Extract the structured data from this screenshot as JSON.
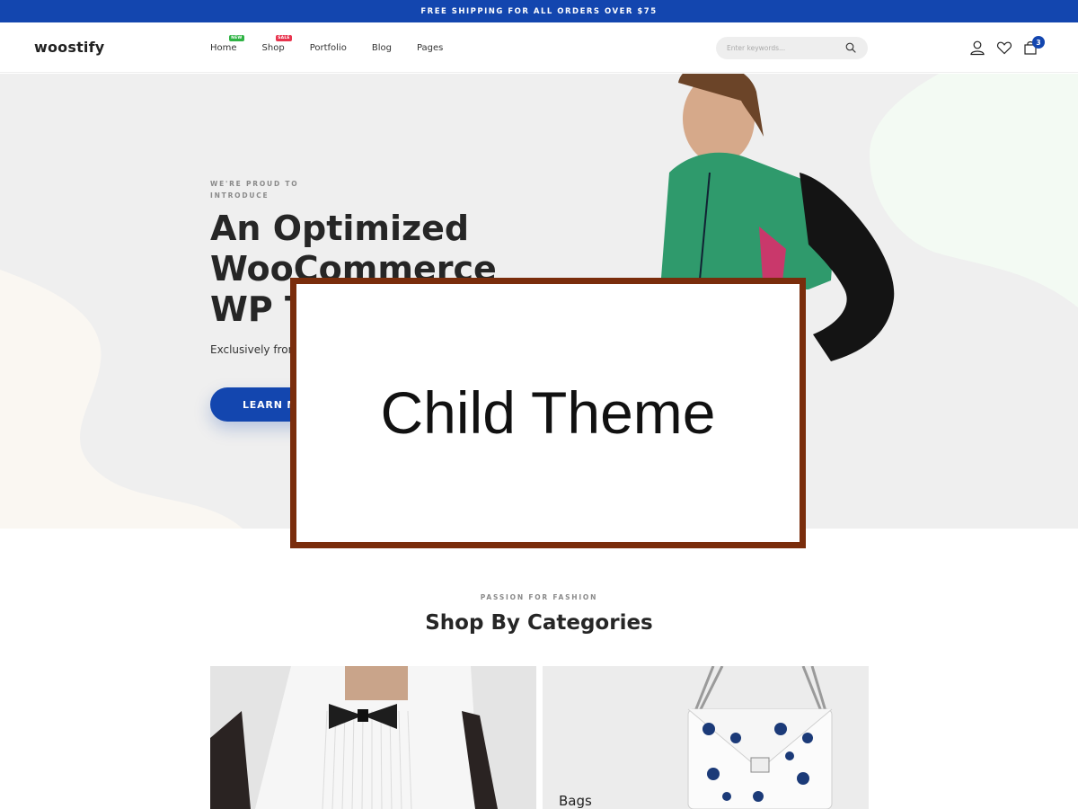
{
  "topbar": {
    "text": "FREE SHIPPING FOR ALL ORDERS OVER $75"
  },
  "header": {
    "logo": "woostify",
    "nav": [
      {
        "label": "Home",
        "badge": "NEW",
        "badge_color": "#2fb344"
      },
      {
        "label": "Shop",
        "badge": "SALE",
        "badge_color": "#e8344e"
      },
      {
        "label": "Portfolio"
      },
      {
        "label": "Blog"
      },
      {
        "label": "Pages"
      }
    ],
    "search_placeholder": "Enter keywords...",
    "cart_count": "3",
    "icons": [
      "search-icon",
      "user-icon",
      "heart-icon",
      "cart-icon"
    ]
  },
  "hero": {
    "eyebrow": "WE'RE PROUD TO INTRODUCE",
    "title": "An Optimized WooCommerce WP Theme",
    "subtitle": "Exclusively from",
    "button": "LEARN MORE"
  },
  "overlay": {
    "text": "Child Theme"
  },
  "categories": {
    "eyebrow": "PASSION FOR FASHION",
    "title": "Shop By Categories",
    "items": [
      {
        "label": ""
      },
      {
        "label": "Bags"
      }
    ]
  },
  "colors": {
    "accent": "#1346af",
    "overlay_border": "#7a2d0c",
    "hero_bg": "#efefef"
  }
}
